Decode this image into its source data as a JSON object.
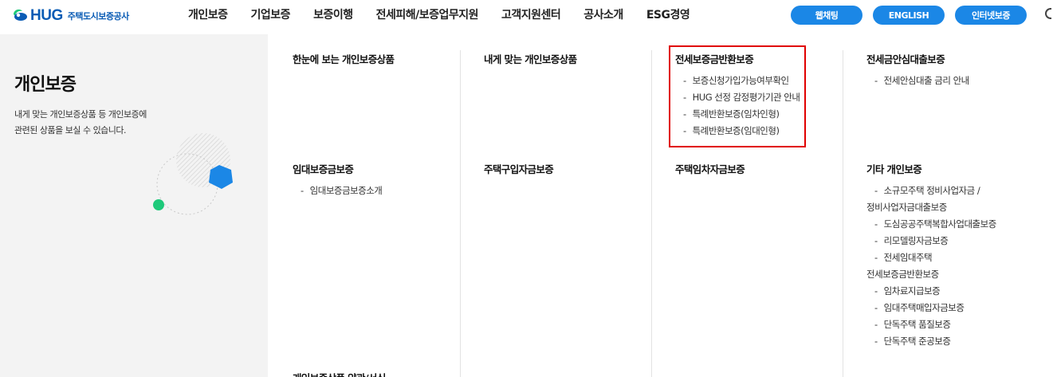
{
  "logo": {
    "text": "HUG",
    "sub": "주택도시보증공사"
  },
  "gnb": [
    "개인보증",
    "기업보증",
    "보증이행",
    "전세피해/보증업무지원",
    "고객지원센터",
    "공사소개",
    "ESG경영"
  ],
  "util": {
    "webchat": "웹채팅",
    "english": "ENGLISH",
    "internet": "인터넷보증"
  },
  "side": {
    "title": "개인보증",
    "desc_line1": "내게 맞는 개인보증상품 등 개인보증에",
    "desc_line2": "관련된 상품을 보실 수 있습니다."
  },
  "menu": {
    "g1": {
      "title": "한눈에 보는 개인보증상품"
    },
    "g2": {
      "title": "내게 맞는 개인보증상품"
    },
    "g3": {
      "title": "전세보증금반환보증",
      "items": [
        "보증신청가입가능여부확인",
        "HUG 선정 감정평가기관 안내",
        "특례반환보증(임차인형)",
        "특례반환보증(임대인형)"
      ]
    },
    "g4": {
      "title": "전세금안심대출보증",
      "items": [
        "전세안심대출 금리 안내"
      ]
    },
    "g5": {
      "title": "임대보증금보증",
      "items": [
        "임대보증금보증소개"
      ]
    },
    "g6": {
      "title": "주택구입자금보증"
    },
    "g7": {
      "title": "주택임차자금보증"
    },
    "g8": {
      "title": "기타 개인보증",
      "items": [
        {
          "l1": "소규모주택 정비사업자금 /",
          "l2": "정비사업자금대출보증"
        },
        {
          "l1": "도심공공주택복합사업대출보증"
        },
        {
          "l1": "리모델링자금보증"
        },
        {
          "l1": "전세임대주택",
          "l2": "전세보증금반환보증"
        },
        {
          "l1": "임차료지급보증"
        },
        {
          "l1": "임대주택매입자금보증"
        },
        {
          "l1": "단독주택 품질보증"
        },
        {
          "l1": "단독주택 준공보증"
        }
      ]
    },
    "g9": {
      "title": "개인보증상품 약관/서식"
    }
  },
  "colors": {
    "brand": "#0a5cb5",
    "pill": "#1b87e6",
    "highlight": "#e00000",
    "accent_green": "#1ec97a"
  }
}
